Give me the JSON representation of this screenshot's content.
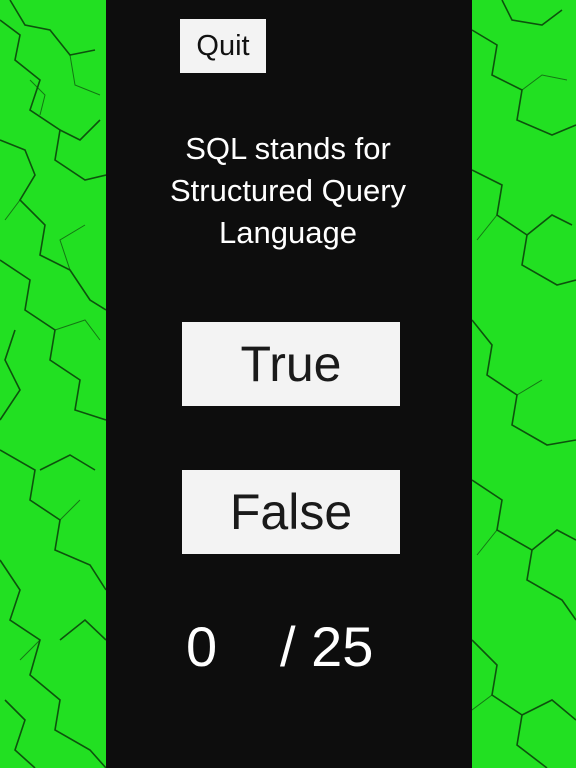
{
  "game": {
    "quit_label": "Quit",
    "question": "SQL stands for Structured Query Language",
    "answers": {
      "true_label": "True",
      "false_label": "False"
    },
    "score": {
      "current": "0",
      "total": "/ 25"
    }
  },
  "colors": {
    "background_green": "#22e022",
    "panel": "#0d0d0d",
    "button": "#f3f3f3"
  }
}
